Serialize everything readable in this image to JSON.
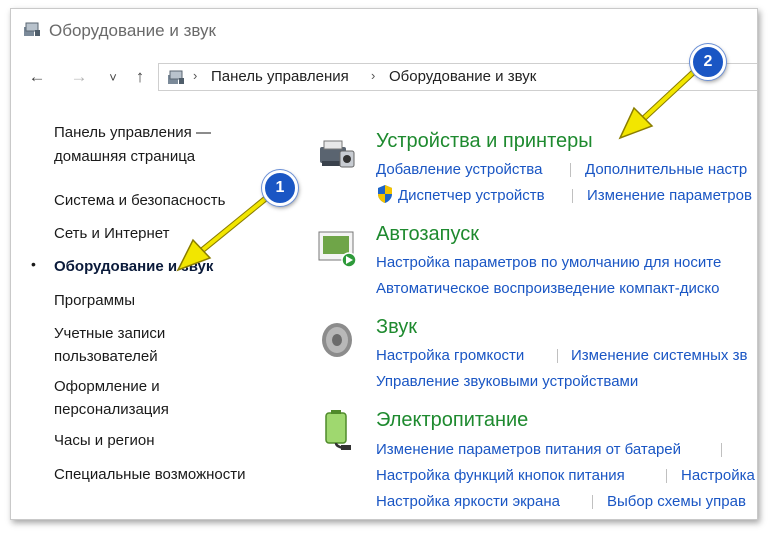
{
  "window": {
    "title": "Оборудование и звук"
  },
  "nav": {
    "back": "←",
    "forward": "→",
    "dropdown": "˅",
    "up": "↑"
  },
  "breadcrumb": {
    "items": [
      "Панель управления",
      "Оборудование и звук"
    ],
    "separator": "›"
  },
  "sidebar": {
    "items": [
      {
        "label": "Панель управления —"
      },
      {
        "label": "домашняя страница"
      },
      {
        "label": "Система и безопасность"
      },
      {
        "label": "Сеть и Интернет"
      },
      {
        "label": "Оборудование и звук"
      },
      {
        "label": "Программы"
      },
      {
        "label": "Учетные записи"
      },
      {
        "label": "пользователей"
      },
      {
        "label": "Оформление и"
      },
      {
        "label": "персонализация"
      },
      {
        "label": "Часы и регион"
      },
      {
        "label": "Специальные возможности"
      }
    ],
    "bullet": "•"
  },
  "categories": [
    {
      "title": "Устройства и принтеры",
      "icon": "printer-icon",
      "links": [
        "Добавление устройства",
        "Дополнительные настр",
        "Диспетчер устройств",
        "Изменение параметров"
      ]
    },
    {
      "title": "Автозапуск",
      "icon": "autoplay-icon",
      "links": [
        "Настройка параметров по умолчанию для носите",
        "Автоматическое воспроизведение компакт-диско"
      ]
    },
    {
      "title": "Звук",
      "icon": "speaker-icon",
      "links": [
        "Настройка громкости",
        "Изменение системных зв",
        "Управление звуковыми устройствами"
      ]
    },
    {
      "title": "Электропитание",
      "icon": "battery-icon",
      "links": [
        "Изменение параметров питания от батарей",
        "Настройка функций кнопок питания",
        "Настройка",
        "Настройка яркости экрана",
        "Выбор схемы управ"
      ]
    }
  ],
  "annotations": {
    "badge1": "1",
    "badge2": "2"
  },
  "colors": {
    "link": "#1a56c4",
    "category": "#1e8a2f",
    "badge": "#1a56c4",
    "arrow": "#f2e600"
  }
}
